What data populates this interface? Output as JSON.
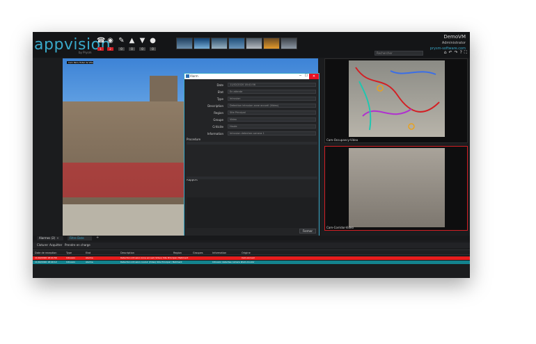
{
  "app": {
    "logo": "appvision",
    "logo_sub": "by Prysm",
    "user": {
      "name": "DemoVM",
      "role": "Administrator",
      "link": "prysm-software.com"
    },
    "search_placeholder": "Rechercher"
  },
  "toolbar_icons": [
    {
      "icon": "phone-icon",
      "badge": "1",
      "badge_color": "#d31f24"
    },
    {
      "icon": "camera-icon",
      "badge": "2",
      "badge_color": "#d31f24"
    },
    {
      "icon": "wrench-icon",
      "badge": "0",
      "badge_color": "#444444"
    },
    {
      "icon": "flame-icon",
      "badge": "0",
      "badge_color": "#444444"
    },
    {
      "icon": "shield-icon",
      "badge": "0",
      "badge_color": "#444444"
    },
    {
      "icon": "lightbulb-icon",
      "badge": "0",
      "badge_color": "#444444"
    }
  ],
  "cameras": {
    "main_tag": "Cam Paris Hotel de Ville",
    "right_top_label": "Cam-Occupancy-Video",
    "right_bottom_label": "Cam-Corridor-Video"
  },
  "dialog": {
    "title": "Alarm",
    "fields": [
      {
        "label": "Date",
        "value": "11/02/2020 18:41:56"
      },
      {
        "label": "Etat",
        "value": "En attente"
      },
      {
        "label": "Type",
        "value": "Intrusion"
      },
      {
        "label": "Description",
        "value": "Detection intrusion zone accueil (Video)"
      },
      {
        "label": "Region",
        "value": "Site Principal"
      },
      {
        "label": "Groupe",
        "value": "Video"
      },
      {
        "label": "Criticite",
        "value": "Haute"
      },
      {
        "label": "Information",
        "value": "Intrusion detectee camera 1"
      }
    ],
    "section_procedure": "Procedure",
    "section_report": "Rapport",
    "close_label": "Fermer"
  },
  "bottom": {
    "tab_alarms": "Alarmes (2)",
    "tab_filter": "Filtre Date",
    "toolbar": [
      "Cloturer",
      "Acquitter",
      "Prendre en charge"
    ],
    "columns": [
      "Date de reception",
      "Type",
      "Etat",
      "Description",
      "Region",
      "Groupes",
      "Information",
      "Origine"
    ],
    "rows": [
      {
        "date": "11/02/2020 18:41:56",
        "type": "Intrusion",
        "etat": "Alarme",
        "description": "Detection intrusion zone accueil (Video) Site Principal / Batiment",
        "region": "",
        "groupes": "",
        "information": "",
        "origine": "Cam-Accueil",
        "color": "#e81d1d"
      },
      {
        "date": "11/02/2020 18:40:12",
        "type": "Intrusion",
        "etat": "Alarme",
        "description": "Detection intrusion couloir (Video) Site Principal / Batiment",
        "region": "",
        "groupes": "",
        "information": "Intrusion detectee camera 2",
        "origine": "Cam-Couloir",
        "color": "#13838e"
      }
    ]
  }
}
